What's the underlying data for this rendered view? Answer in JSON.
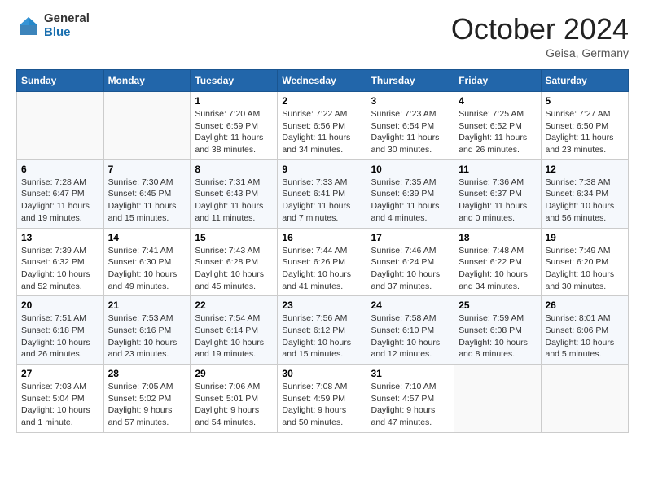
{
  "header": {
    "logo_general": "General",
    "logo_blue": "Blue",
    "month": "October 2024",
    "location": "Geisa, Germany"
  },
  "weekdays": [
    "Sunday",
    "Monday",
    "Tuesday",
    "Wednesday",
    "Thursday",
    "Friday",
    "Saturday"
  ],
  "weeks": [
    [
      {
        "day": "",
        "info": ""
      },
      {
        "day": "",
        "info": ""
      },
      {
        "day": "1",
        "info": "Sunrise: 7:20 AM\nSunset: 6:59 PM\nDaylight: 11 hours and 38 minutes."
      },
      {
        "day": "2",
        "info": "Sunrise: 7:22 AM\nSunset: 6:56 PM\nDaylight: 11 hours and 34 minutes."
      },
      {
        "day": "3",
        "info": "Sunrise: 7:23 AM\nSunset: 6:54 PM\nDaylight: 11 hours and 30 minutes."
      },
      {
        "day": "4",
        "info": "Sunrise: 7:25 AM\nSunset: 6:52 PM\nDaylight: 11 hours and 26 minutes."
      },
      {
        "day": "5",
        "info": "Sunrise: 7:27 AM\nSunset: 6:50 PM\nDaylight: 11 hours and 23 minutes."
      }
    ],
    [
      {
        "day": "6",
        "info": "Sunrise: 7:28 AM\nSunset: 6:47 PM\nDaylight: 11 hours and 19 minutes."
      },
      {
        "day": "7",
        "info": "Sunrise: 7:30 AM\nSunset: 6:45 PM\nDaylight: 11 hours and 15 minutes."
      },
      {
        "day": "8",
        "info": "Sunrise: 7:31 AM\nSunset: 6:43 PM\nDaylight: 11 hours and 11 minutes."
      },
      {
        "day": "9",
        "info": "Sunrise: 7:33 AM\nSunset: 6:41 PM\nDaylight: 11 hours and 7 minutes."
      },
      {
        "day": "10",
        "info": "Sunrise: 7:35 AM\nSunset: 6:39 PM\nDaylight: 11 hours and 4 minutes."
      },
      {
        "day": "11",
        "info": "Sunrise: 7:36 AM\nSunset: 6:37 PM\nDaylight: 11 hours and 0 minutes."
      },
      {
        "day": "12",
        "info": "Sunrise: 7:38 AM\nSunset: 6:34 PM\nDaylight: 10 hours and 56 minutes."
      }
    ],
    [
      {
        "day": "13",
        "info": "Sunrise: 7:39 AM\nSunset: 6:32 PM\nDaylight: 10 hours and 52 minutes."
      },
      {
        "day": "14",
        "info": "Sunrise: 7:41 AM\nSunset: 6:30 PM\nDaylight: 10 hours and 49 minutes."
      },
      {
        "day": "15",
        "info": "Sunrise: 7:43 AM\nSunset: 6:28 PM\nDaylight: 10 hours and 45 minutes."
      },
      {
        "day": "16",
        "info": "Sunrise: 7:44 AM\nSunset: 6:26 PM\nDaylight: 10 hours and 41 minutes."
      },
      {
        "day": "17",
        "info": "Sunrise: 7:46 AM\nSunset: 6:24 PM\nDaylight: 10 hours and 37 minutes."
      },
      {
        "day": "18",
        "info": "Sunrise: 7:48 AM\nSunset: 6:22 PM\nDaylight: 10 hours and 34 minutes."
      },
      {
        "day": "19",
        "info": "Sunrise: 7:49 AM\nSunset: 6:20 PM\nDaylight: 10 hours and 30 minutes."
      }
    ],
    [
      {
        "day": "20",
        "info": "Sunrise: 7:51 AM\nSunset: 6:18 PM\nDaylight: 10 hours and 26 minutes."
      },
      {
        "day": "21",
        "info": "Sunrise: 7:53 AM\nSunset: 6:16 PM\nDaylight: 10 hours and 23 minutes."
      },
      {
        "day": "22",
        "info": "Sunrise: 7:54 AM\nSunset: 6:14 PM\nDaylight: 10 hours and 19 minutes."
      },
      {
        "day": "23",
        "info": "Sunrise: 7:56 AM\nSunset: 6:12 PM\nDaylight: 10 hours and 15 minutes."
      },
      {
        "day": "24",
        "info": "Sunrise: 7:58 AM\nSunset: 6:10 PM\nDaylight: 10 hours and 12 minutes."
      },
      {
        "day": "25",
        "info": "Sunrise: 7:59 AM\nSunset: 6:08 PM\nDaylight: 10 hours and 8 minutes."
      },
      {
        "day": "26",
        "info": "Sunrise: 8:01 AM\nSunset: 6:06 PM\nDaylight: 10 hours and 5 minutes."
      }
    ],
    [
      {
        "day": "27",
        "info": "Sunrise: 7:03 AM\nSunset: 5:04 PM\nDaylight: 10 hours and 1 minute."
      },
      {
        "day": "28",
        "info": "Sunrise: 7:05 AM\nSunset: 5:02 PM\nDaylight: 9 hours and 57 minutes."
      },
      {
        "day": "29",
        "info": "Sunrise: 7:06 AM\nSunset: 5:01 PM\nDaylight: 9 hours and 54 minutes."
      },
      {
        "day": "30",
        "info": "Sunrise: 7:08 AM\nSunset: 4:59 PM\nDaylight: 9 hours and 50 minutes."
      },
      {
        "day": "31",
        "info": "Sunrise: 7:10 AM\nSunset: 4:57 PM\nDaylight: 9 hours and 47 minutes."
      },
      {
        "day": "",
        "info": ""
      },
      {
        "day": "",
        "info": ""
      }
    ]
  ]
}
